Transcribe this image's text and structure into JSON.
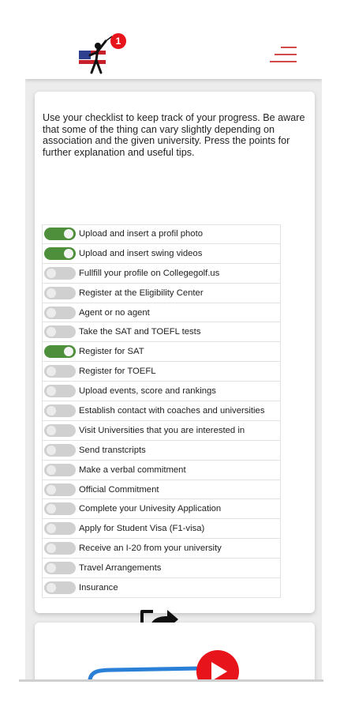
{
  "header": {
    "logo_icon": "golfer-flag-logo-icon",
    "notification_count": "1",
    "menu_icon": "hamburger-menu-icon",
    "accent_color": "#e8141c"
  },
  "intro_text": "Use your checklist to keep track of your progress. Be aware that some of the thing can vary slightly depending on association and the given university. Press the points for further explanation and useful tips.",
  "checklist": [
    {
      "label": "Upload and insert a profil photo",
      "checked": true
    },
    {
      "label": "Upload and insert swing videos",
      "checked": true
    },
    {
      "label": "Fullfill your profile on Collegegolf.us",
      "checked": false
    },
    {
      "label": "Register at the Eligibility Center",
      "checked": false
    },
    {
      "label": "Agent or no agent",
      "checked": false
    },
    {
      "label": "Take the SAT and TOEFL tests",
      "checked": false
    },
    {
      "label": "Register for SAT",
      "checked": true
    },
    {
      "label": "Register for TOEFL",
      "checked": false
    },
    {
      "label": "Upload events, score and rankings",
      "checked": false
    },
    {
      "label": "Establish contact with coaches and universities",
      "checked": false
    },
    {
      "label": "Visit Universities that you are interested in",
      "checked": false
    },
    {
      "label": "Send transtcripts",
      "checked": false
    },
    {
      "label": "Make a verbal commitment",
      "checked": false
    },
    {
      "label": "Official Commitment",
      "checked": false
    },
    {
      "label": "Complete your Univesity Application",
      "checked": false
    },
    {
      "label": "Apply for Student Visa (F1-visa)",
      "checked": false
    },
    {
      "label": "Receive an I-20 from your university",
      "checked": false
    },
    {
      "label": "Travel Arrangements",
      "checked": false
    },
    {
      "label": "Insurance",
      "checked": false
    }
  ],
  "share_icon": "share-icon",
  "video_card": {
    "play_icon": "play-icon",
    "play_color": "#e8141c"
  },
  "colors": {
    "toggle_on": "#4e8f3b",
    "toggle_off": "#d0d0d0"
  }
}
